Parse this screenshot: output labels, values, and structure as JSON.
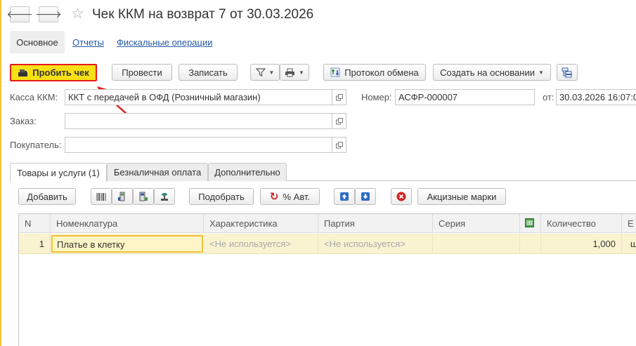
{
  "header": {
    "back_glyph": "🡐",
    "forward_glyph": "🡒",
    "star_glyph": "☆",
    "title": "Чек ККМ на возврат 7 от 30.03.2026"
  },
  "sections": {
    "main": "Основное",
    "reports": "Отчеты",
    "fiscal": "Фискальные операции"
  },
  "toolbar": {
    "print_receipt": "Пробить чек",
    "post": "Провести",
    "save": "Записать",
    "exchange_log": "Протокол обмена",
    "create_based": "Создать на основании",
    "caret": "▼"
  },
  "form": {
    "kassa_label": "Касса ККМ:",
    "kassa_value": "ККТ с передачей в ОФД (Розничный магазин)",
    "number_label": "Номер:",
    "number_value": "АСФР-000007",
    "date_label": "от:",
    "date_value": "30.03.2026 16:07:0",
    "order_label": "Заказ:",
    "order_value": "",
    "buyer_label": "Покупатель:",
    "buyer_value": ""
  },
  "tabs": [
    {
      "label": "Товары и услуги (1)"
    },
    {
      "label": "Безналичная оплата"
    },
    {
      "label": "Дополнительно"
    }
  ],
  "table_toolbar": {
    "add": "Добавить",
    "pick": "Подобрать",
    "percent_auto": "% Авт.",
    "excise": "Акцизные марки"
  },
  "table": {
    "columns": [
      "N",
      "Номенклатура",
      "Характеристика",
      "Партия",
      "Серия",
      "",
      "Количество",
      "Е"
    ],
    "rows": [
      {
        "n": "1",
        "item": "Платье в клетку",
        "characteristic": "<Не используется>",
        "batch": "<Не используется>",
        "series": "",
        "mark": "",
        "quantity": "1,000",
        "unit": "ш"
      }
    ]
  },
  "colors": {
    "accent_yellow": "#f7e015",
    "highlight_red": "#e21b1b",
    "link_blue": "#2458a6",
    "row_selected": "#faf3d1"
  }
}
